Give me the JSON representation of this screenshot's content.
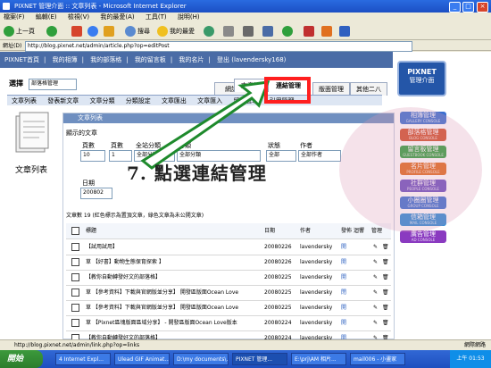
{
  "window": {
    "title": "PIXNET 管理介面 :: 文章列表 - Microsoft Internet Explorer"
  },
  "menu": [
    "檔案(F)",
    "編輯(E)",
    "檢視(V)",
    "我的最愛(A)",
    "工具(T)",
    "說明(H)"
  ],
  "toolbar": {
    "back": "上一頁",
    "search": "搜尋",
    "favorites": "我的最愛"
  },
  "address": {
    "label": "網址(D)",
    "value": "http://blog.pixnet.net/admin/article.php?op=editPost"
  },
  "topnav": [
    "PIXNET首頁",
    "我的相簿",
    "我的部落格",
    "我的留言板",
    "我的名片",
    "登出"
  ],
  "user": "登出 (lavendersky168)",
  "logo": {
    "line1": "PIXNET",
    "line2": "管理介面"
  },
  "side_menu": [
    {
      "label": "相簿管理",
      "sub": "GALLERY CONSOLE",
      "color": "#3a6fd0"
    },
    {
      "label": "部落格管理",
      "sub": "BLOG CONSOLE",
      "color": "#d0502a"
    },
    {
      "label": "留言板管理",
      "sub": "GUESTBOOK CONSOLE",
      "color": "#2f9f3c"
    },
    {
      "label": "名片管理",
      "sub": "PROFILE CONSOLE",
      "color": "#e06a1c"
    },
    {
      "label": "社群管理",
      "sub": "PEOPLE CONSOLE",
      "color": "#6b4fc0"
    },
    {
      "label": "小圈圈管理",
      "sub": "GROUP CONSOLE",
      "color": "#3a6fd0"
    },
    {
      "label": "信箱管理",
      "sub": "MAIL CONSOLE",
      "color": "#2c8bd6"
    },
    {
      "label": "廣告管理",
      "sub": "AD CONSOLE",
      "color": "#8a3ac0"
    }
  ],
  "page_select": {
    "label": "選擇",
    "value": "部落格管理"
  },
  "tabs": [
    "網誌管理",
    "文章管理",
    "連結管理",
    "版面管理",
    "其他二八"
  ],
  "subtabs": [
    "文章列表",
    "發表新文章",
    "文章分類",
    "分類設定",
    "文章匯出",
    "文章匯入",
    "留言管理",
    "引用管理"
  ],
  "left_panel_title": "文章列表",
  "section_title": "文章列表",
  "filter": {
    "label": "顯示的文章",
    "headers": [
      "頁數",
      "頁數",
      "全站分類",
      "分類",
      "狀態",
      "作者"
    ],
    "values": [
      "10",
      "1",
      "全部分類",
      "全部分類",
      "全部",
      "全部作者"
    ],
    "date_label": "日期",
    "date_value": "200802"
  },
  "list_header": {
    "note": "文章數 19 (紅色標示為置頂文章，綠色文章為未公開文章)",
    "cols": [
      "標題",
      "日期",
      "作者",
      "發佈",
      "迴響",
      "管理"
    ]
  },
  "articles": [
    {
      "title": "【試用試用】",
      "date": "20080226",
      "author": "lavendersky",
      "status": "開"
    },
    {
      "title": "草 【好書】動物生態保育探索 】",
      "date": "20080226",
      "author": "lavendersky",
      "status": "開"
    },
    {
      "title": "【教你自動轉發好文的部落格】",
      "date": "20080225",
      "author": "lavendersky",
      "status": "開"
    },
    {
      "title": "草 【參考資料】下載與官網版並分享】 開發區版面Ocean Love",
      "date": "20080225",
      "author": "lavendersky",
      "status": "閉"
    },
    {
      "title": "草 【參考資料】下載與官網版並分享】 開發區版面Ocean Love",
      "date": "20080225",
      "author": "lavendersky",
      "status": "開"
    },
    {
      "title": "草 【Pixnet區塊版面區域分享】 - 開發區版面Ocean Love版本",
      "date": "20080224",
      "author": "lavendersky",
      "status": "開"
    },
    {
      "title": "【教你自動轉發好文的部落格】",
      "date": "20080224",
      "author": "lavendersky",
      "status": "開"
    }
  ],
  "instruction": "7. 點選連結管理",
  "statusbar": {
    "url": "http://blog.pixnet.net/admin/link.php?op=links",
    "zone": "網際網路"
  },
  "taskbar": {
    "start": "開始",
    "tasks": [
      "4 Internet Expl...",
      "Ulead GIF Animat...",
      "D:\\my documents\\...",
      "PIXNET 管理...",
      "E:\\prj\\AM 相片...",
      "mail006 - 小畫家"
    ],
    "clock": "上午 01:53"
  }
}
